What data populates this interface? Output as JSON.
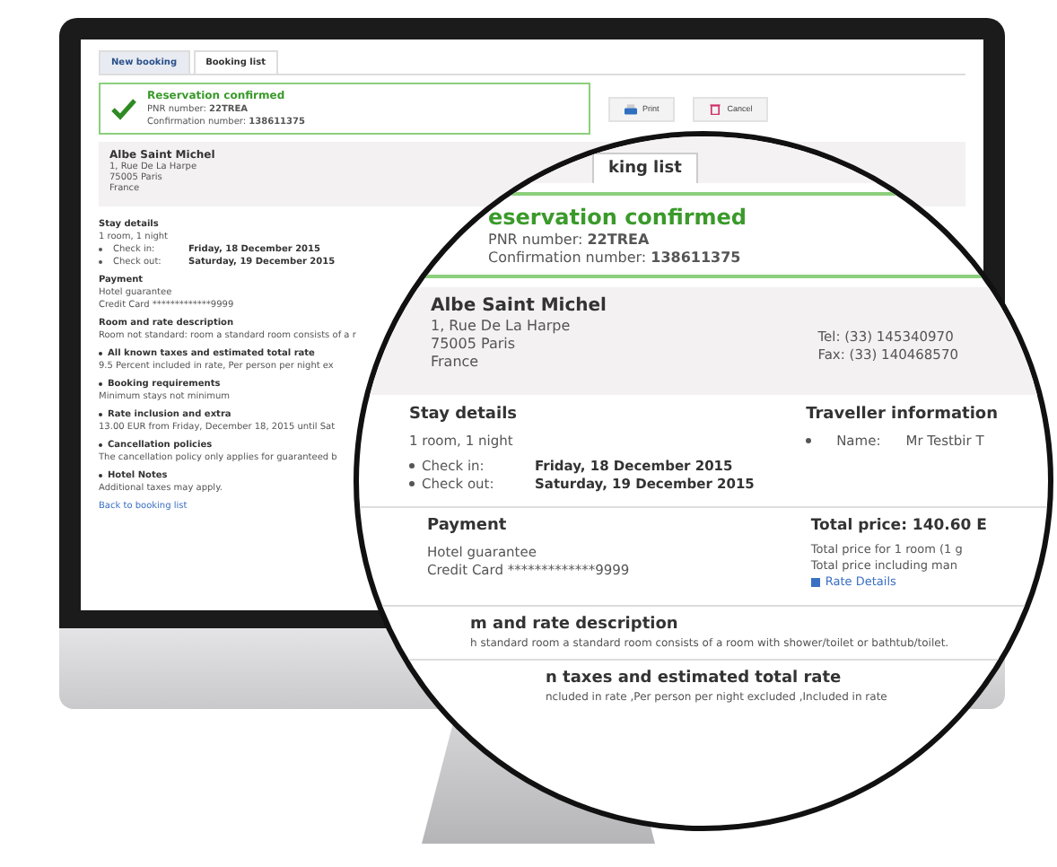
{
  "tabs": [
    {
      "label": "New booking",
      "selected": false
    },
    {
      "label": "Booking list",
      "selected": true
    }
  ],
  "confirmation": {
    "title": "Reservation confirmed",
    "pnr_label": "PNR number:",
    "pnr": "22TREA",
    "conf_label": "Confirmation number:",
    "conf": "138611375"
  },
  "buttons": [
    {
      "label": "Print",
      "kind": "print"
    },
    {
      "label": "Cancel",
      "kind": "cancel"
    }
  ],
  "hotel": {
    "name": "Albe Saint Michel",
    "address": [
      "1, Rue De La Harpe",
      "75005 Paris",
      "France"
    ]
  },
  "stay": {
    "title": "Stay details",
    "summary": "1 room, 1 night",
    "rows": [
      {
        "label": "Check in:",
        "value": "Friday, 18 December 2015"
      },
      {
        "label": "Check out:",
        "value": "Saturday, 19 December 2015"
      }
    ]
  },
  "payment": {
    "title": "Payment",
    "lines": [
      "Hotel guarantee",
      "Credit Card *************9999"
    ]
  },
  "rate": {
    "title": "Room and rate description",
    "text": "Room not standard: room a standard room consists of a r"
  },
  "policies": [
    {
      "title": "All known taxes and estimated total rate",
      "text": "9.5 Percent included in rate, Per person per night ex"
    },
    {
      "title": "Booking requirements",
      "text": "Minimum stays not minimum"
    },
    {
      "title": "Rate inclusion and extra",
      "text": "13.00 EUR from Friday, December 18, 2015 until Sat"
    },
    {
      "title": "Cancellation policies",
      "text": "The cancellation policy only applies for guaranteed b"
    },
    {
      "title": "Hotel Notes",
      "text": "Additional taxes may apply."
    }
  ],
  "back_link": "Back to booking list",
  "magnifier": {
    "tab": "king list",
    "confirmation": {
      "title": "eservation confirmed",
      "pnr_label": "PNR number:",
      "pnr": "22TREA",
      "conf_label": "Confirmation number:",
      "conf": "138611375"
    },
    "hotel": {
      "name": "Albe Saint Michel",
      "address": [
        "1, Rue De La Harpe",
        "75005 Paris",
        "France"
      ],
      "tel": "Tel: (33) 145340970",
      "fax": "Fax: (33) 140468570"
    },
    "stay": {
      "title": "Stay details",
      "summary": "1 room, 1 night",
      "rows": [
        {
          "label": "Check in:",
          "value": "Friday, 18 December 2015"
        },
        {
          "label": "Check out:",
          "value": "Saturday, 19 December 2015"
        }
      ]
    },
    "traveller": {
      "title": "Traveller information",
      "label": "Name:",
      "value": "Mr Testbir T"
    },
    "payment": {
      "title": "Payment",
      "lines": [
        "Hotel guarantee",
        "Credit Card *************9999"
      ]
    },
    "total": {
      "title": "Total price: 140.60 E",
      "lines": [
        "Total price for 1 room (1 g",
        "Total price including man"
      ],
      "link": "Rate Details"
    },
    "rate": {
      "title": "m and rate description",
      "text": "h standard room a standard room consists of a room with shower/toilet or bathtub/toilet."
    },
    "taxes": {
      "title": "n taxes and estimated total rate",
      "text": "ncluded in rate ,Per person per night excluded ,Included in rate"
    }
  }
}
